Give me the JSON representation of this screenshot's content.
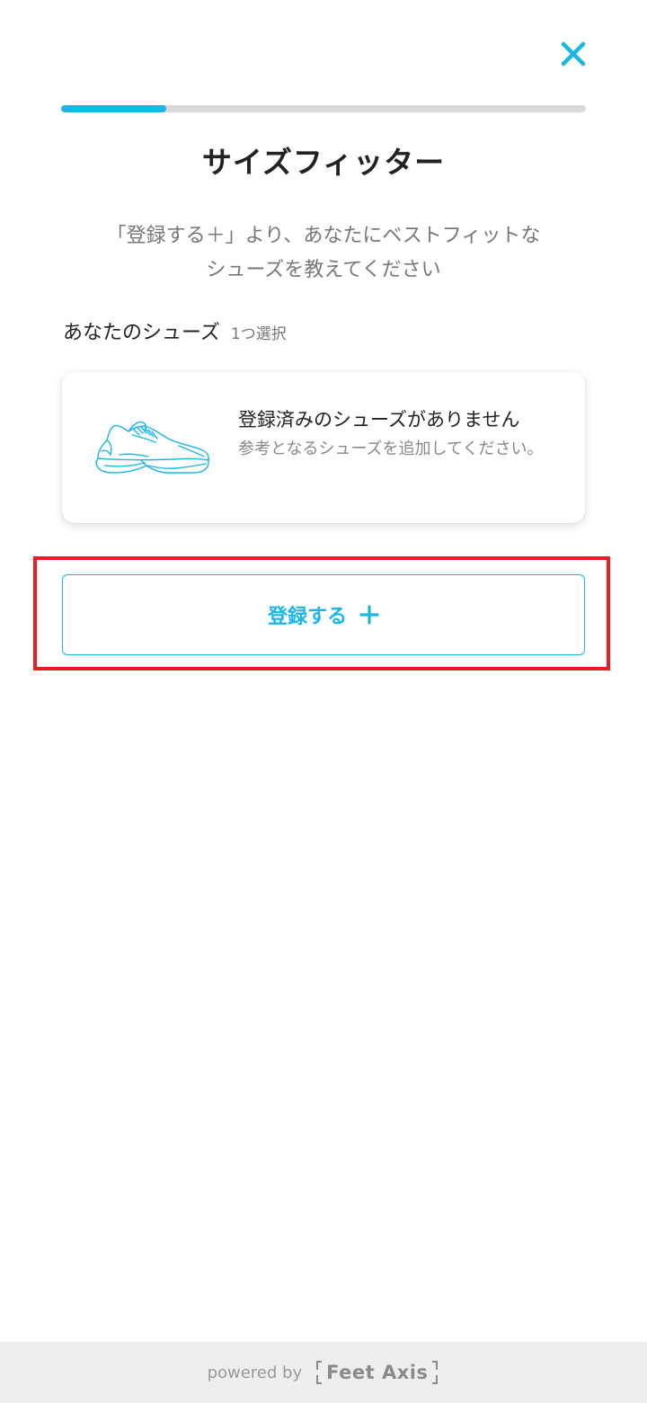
{
  "header": {
    "close_icon": "close-icon",
    "progress": 0.2
  },
  "page": {
    "title": "サイズフィッター",
    "instruction_line1": "「登録する＋」より、あなたにベストフィット",
    "instruction_line1_end": "な",
    "instruction_line2": "シューズを教えてください"
  },
  "section": {
    "label": "あなたのシューズ",
    "sublabel": "1つ選択"
  },
  "empty_state": {
    "icon": "shoe-icon",
    "title": "登録済みのシューズがありません",
    "description": "参考となるシューズを追加してください。"
  },
  "register_button": {
    "label": "登録する",
    "icon": "plus-icon"
  },
  "footer": {
    "powered_by": "powered by",
    "brand": "Feet Axis"
  },
  "colors": {
    "accent": "#1ab6e6",
    "highlight": "#ec1c24"
  }
}
